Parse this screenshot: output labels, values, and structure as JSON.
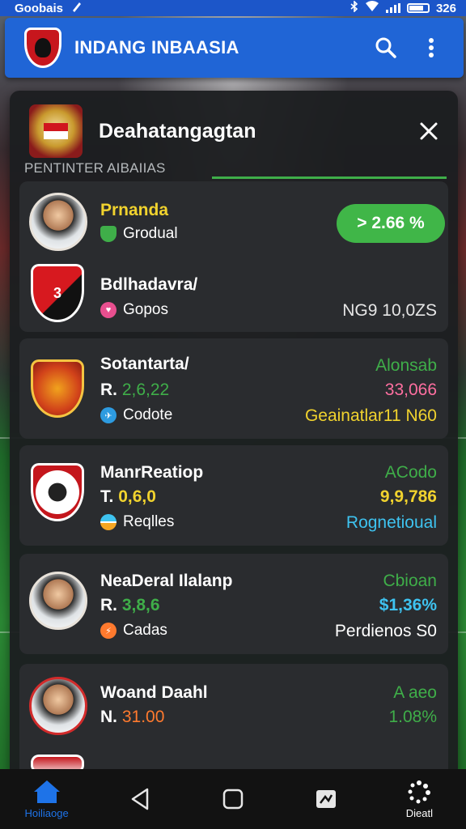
{
  "status_bar": {
    "left_text": "Goobais",
    "time": "326"
  },
  "app_bar": {
    "title": "INDANG INBAASIA",
    "search_icon": "search-icon",
    "menu_icon": "more-vert-icon"
  },
  "panel": {
    "title": "Deahatangagtan",
    "section_label": "PENTINTER AIBAIIAS",
    "close_icon": "close-icon"
  },
  "cards": [
    {
      "rows": [
        {
          "name": "Prnanda",
          "sub_label": "Grodual",
          "sub_icon": "shield-icon",
          "pill": "> 2.66 %"
        },
        {
          "name": "Bdlhadavra/",
          "sub_label": "Gopos",
          "sub_icon": "heart-icon",
          "right_text": "NG9 10,0ZS"
        }
      ]
    },
    {
      "name": "Sotantarta/",
      "value_prefix": "R.",
      "value": "2,6,22",
      "sub_label": "Codote",
      "sub_icon": "plane-icon",
      "right_top": "Alonsab",
      "right_mid": "33,066",
      "right_bottom": "Geainatlar11 N60"
    },
    {
      "name": "ManrReatiop",
      "value_prefix": "T.",
      "value": "0,6,0",
      "sub_label": "Reqlles",
      "sub_icon": "flag-icon",
      "right_top": "ACodo",
      "right_mid": "9,9,786",
      "right_bottom": "Rognetioual"
    },
    {
      "name": "NeaDeral Ilalanp",
      "value_prefix": "R.",
      "value": "3,8,6",
      "sub_label": "Cadas",
      "sub_icon": "bolt-icon",
      "right_top": "Cbioan",
      "right_mid": "$1,36%",
      "right_bottom": "Perdienos S0"
    },
    {
      "name": "Woand Daahl",
      "value_prefix": "N.",
      "value": "31.00",
      "right_top": "A aeo",
      "right_mid": "1.08%"
    }
  ],
  "bottom_nav": {
    "home_label": "Hoiliaoge",
    "other_label": "Dieatl"
  },
  "colors": {
    "app_bar": "#2065d6",
    "accent_green": "#40b648",
    "yellow": "#f1d32e",
    "pink": "#ff6fa0",
    "cyan": "#3ec3f0",
    "orange": "#ff7a2e"
  }
}
